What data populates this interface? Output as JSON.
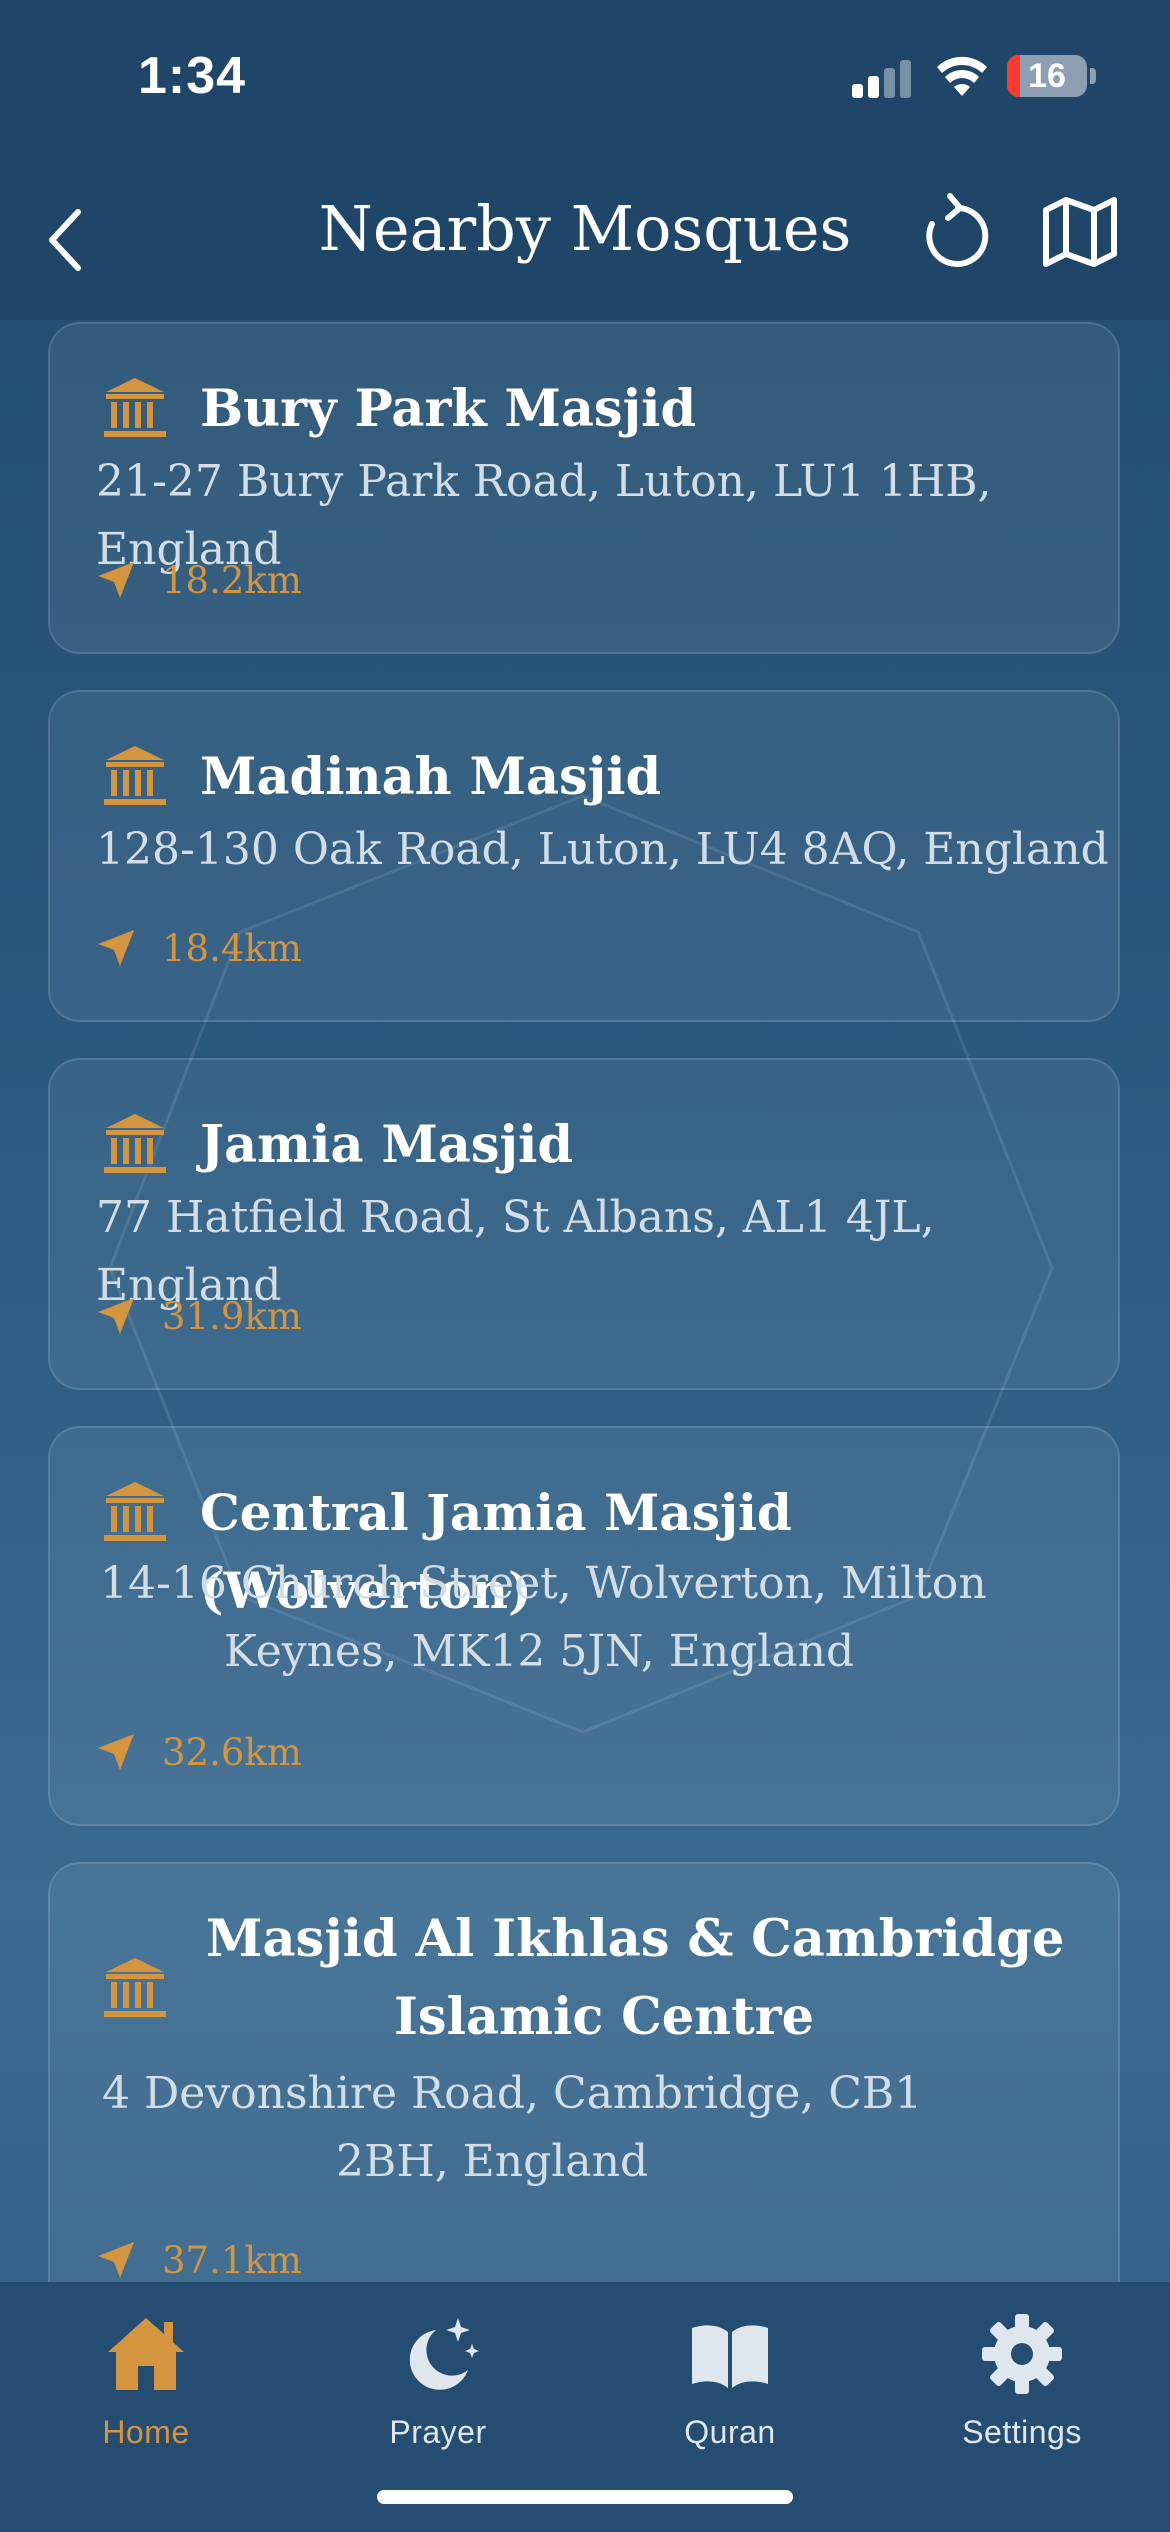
{
  "status_bar": {
    "time": "1:34",
    "battery": "16",
    "battery_level": 0.16
  },
  "header": {
    "title": "Nearby Mosques"
  },
  "colors": {
    "accent": "#d4953e",
    "background": "#2b5a80",
    "header": "#1f4668"
  },
  "mosques": [
    {
      "name": "Bury Park Masjid",
      "address_lines": [
        "21-27 Bury Park Road, Luton, LU1 1HB, England"
      ],
      "distance": "18.2km"
    },
    {
      "name": "Madinah Masjid",
      "address_lines": [
        "128-130 Oak Road, Luton, LU4 8AQ, England"
      ],
      "distance": "18.4km"
    },
    {
      "name": "Jamia Masjid",
      "address_lines": [
        "77 Hatfield Road, St Albans, AL1 4JL, England"
      ],
      "distance": "31.9km"
    },
    {
      "name": "Central Jamia Masjid (Wolverton)",
      "address_lines": [
        "14-16 Church Street, Wolverton, Milton",
        "Keynes, MK12 5JN, England"
      ],
      "distance": "32.6km"
    },
    {
      "name_lines": [
        "Masjid Al Ikhlas & Cambridge",
        "Islamic Centre"
      ],
      "address_lines": [
        "4 Devonshire Road, Cambridge, CB1",
        "2BH, England"
      ],
      "distance": "37.1km"
    }
  ],
  "tabs": [
    {
      "label": "Home",
      "icon": "home-icon",
      "active": true
    },
    {
      "label": "Prayer",
      "icon": "moon-stars-icon",
      "active": false
    },
    {
      "label": "Quran",
      "icon": "book-icon",
      "active": false
    },
    {
      "label": "Settings",
      "icon": "gear-icon",
      "active": false
    }
  ]
}
